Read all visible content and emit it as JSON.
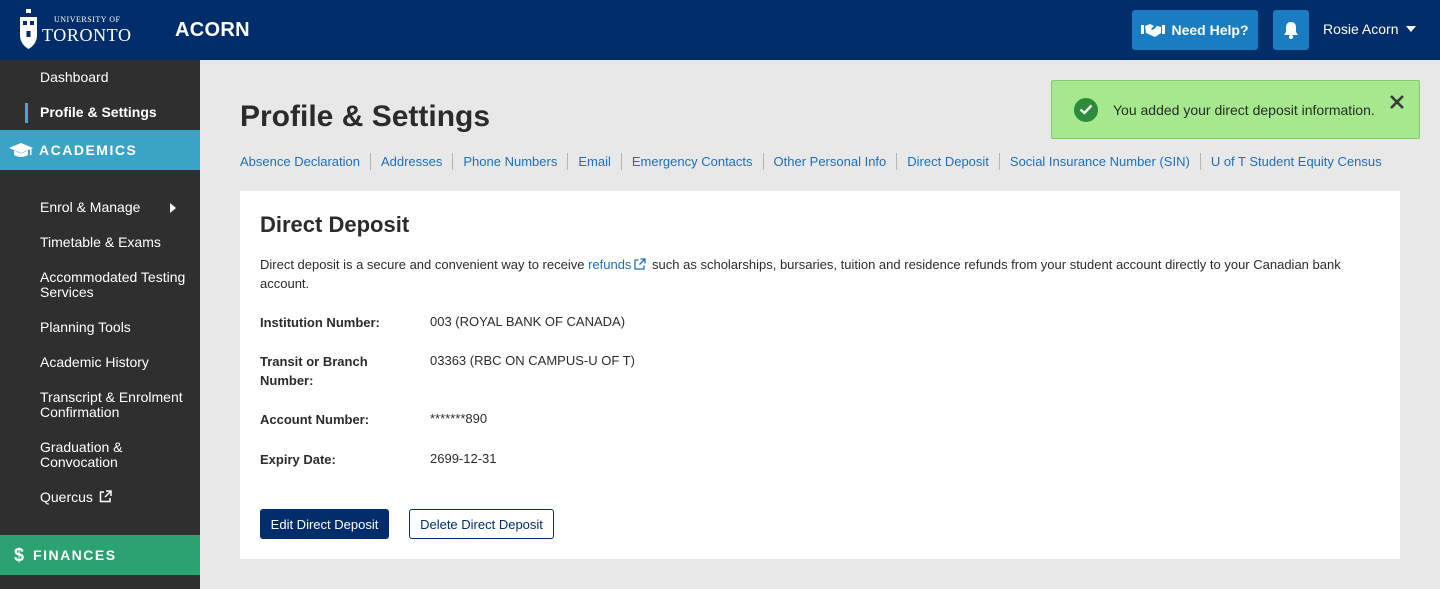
{
  "header": {
    "logo_small": "UNIVERSITY OF",
    "logo_big": "TORONTO",
    "app_title": "ACORN",
    "help_label": "Need Help?",
    "user_name": "Rosie Acorn",
    "bar_color": "#012e6b",
    "button_color": "#1a7dc2"
  },
  "sidebar": {
    "dashboard": "Dashboard",
    "profile": "Profile & Settings",
    "academics": "ACADEMICS",
    "items": [
      "Enrol & Manage",
      "Timetable & Exams",
      "Accommodated Testing Services",
      "Planning Tools",
      "Academic History",
      "Transcript & Enrolment Confirmation",
      "Graduation & Convocation",
      "Quercus"
    ],
    "finances": "FINANCES",
    "academics_color": "#3aa3c6",
    "finances_color": "#2ba371"
  },
  "page": {
    "title": "Profile & Settings",
    "tabs": [
      "Absence Declaration",
      "Addresses",
      "Phone Numbers",
      "Email",
      "Emergency Contacts",
      "Other Personal Info",
      "Direct Deposit",
      "Social Insurance Number (SIN)",
      "U of T Student Equity Census"
    ]
  },
  "toast": {
    "message": "You added your direct deposit information."
  },
  "card": {
    "title": "Direct Deposit",
    "intro_before": "Direct deposit is a secure and convenient way to receive ",
    "intro_link": "refunds",
    "intro_after": " such as scholarships, bursaries, tuition and residence refunds from your student account directly to your Canadian bank account.",
    "fields": [
      {
        "label": "Institution Number:",
        "value": "003 (ROYAL BANK OF CANADA)"
      },
      {
        "label": "Transit or Branch Number:",
        "value": "03363 (RBC ON CAMPUS-U OF T)"
      },
      {
        "label": "Account Number:",
        "value": "*******890"
      },
      {
        "label": "Expiry Date:",
        "value": "2699-12-31"
      }
    ],
    "edit_label": "Edit Direct Deposit",
    "delete_label": "Delete Direct Deposit"
  }
}
